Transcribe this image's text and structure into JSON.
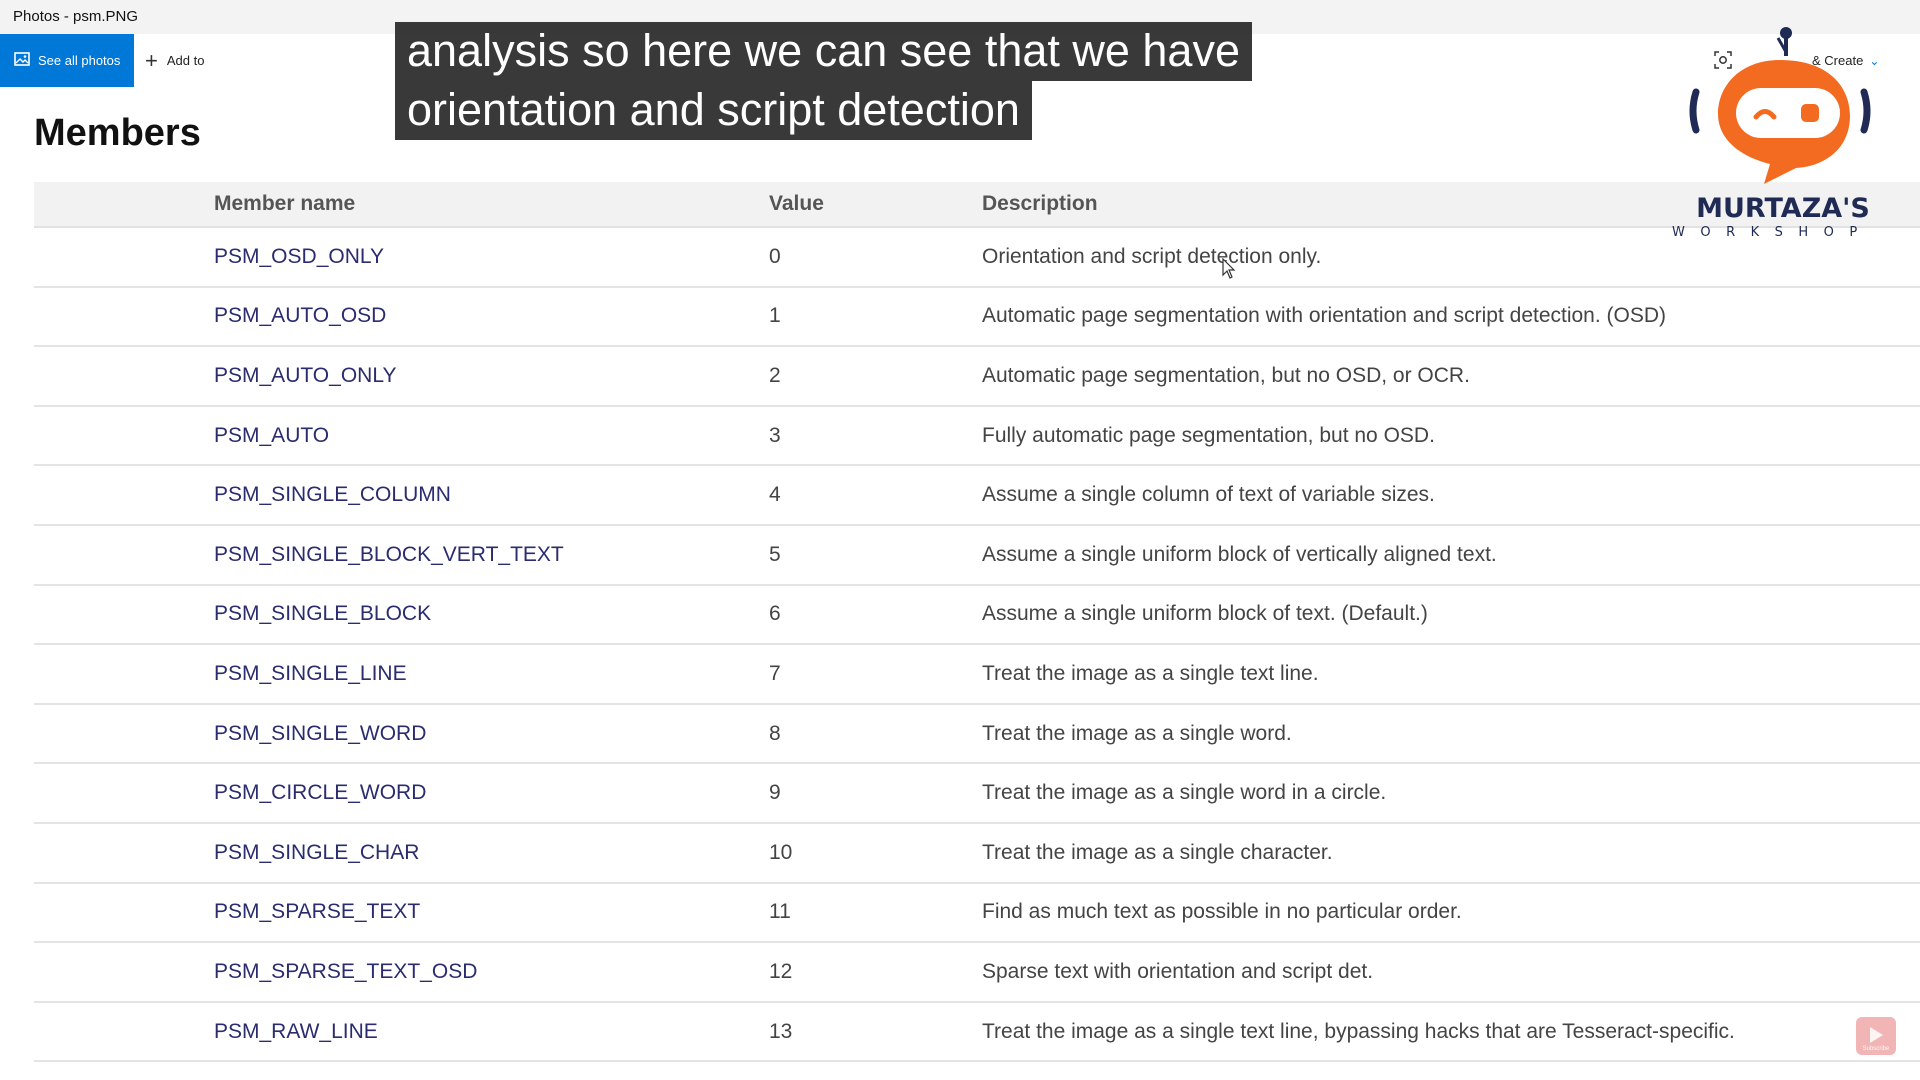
{
  "window": {
    "title": "Photos - psm.PNG"
  },
  "toolbar": {
    "see_all_label": "See all photos",
    "see_all_icon": "photo-library-icon",
    "add_to_label": "Add to",
    "add_to_icon": "plus-icon",
    "edit_create_label": "& Create",
    "edit_create_icon": "chevron-down-icon",
    "accent_color": "#0078d7"
  },
  "page": {
    "title": "Members"
  },
  "table": {
    "headers": {
      "name": "Member name",
      "value": "Value",
      "description": "Description"
    },
    "rows": [
      {
        "name": "PSM_OSD_ONLY",
        "value": "0",
        "description": "Orientation and script detection only."
      },
      {
        "name": "PSM_AUTO_OSD",
        "value": "1",
        "description": "Automatic page segmentation with orientation and script detection. (OSD)"
      },
      {
        "name": "PSM_AUTO_ONLY",
        "value": "2",
        "description": "Automatic page segmentation, but no OSD, or OCR."
      },
      {
        "name": "PSM_AUTO",
        "value": "3",
        "description": "Fully automatic page segmentation, but no OSD."
      },
      {
        "name": "PSM_SINGLE_COLUMN",
        "value": "4",
        "description": "Assume a single column of text of variable sizes."
      },
      {
        "name": "PSM_SINGLE_BLOCK_VERT_TEXT",
        "value": "5",
        "description": "Assume a single uniform block of vertically aligned text."
      },
      {
        "name": "PSM_SINGLE_BLOCK",
        "value": "6",
        "description": "Assume a single uniform block of text. (Default.)"
      },
      {
        "name": "PSM_SINGLE_LINE",
        "value": "7",
        "description": "Treat the image as a single text line."
      },
      {
        "name": "PSM_SINGLE_WORD",
        "value": "8",
        "description": "Treat the image as a single word."
      },
      {
        "name": "PSM_CIRCLE_WORD",
        "value": "9",
        "description": "Treat the image as a single word in a circle."
      },
      {
        "name": "PSM_SINGLE_CHAR",
        "value": "10",
        "description": "Treat the image as a single character."
      },
      {
        "name": "PSM_SPARSE_TEXT",
        "value": "11",
        "description": "Find as much text as possible in no particular order."
      },
      {
        "name": "PSM_SPARSE_TEXT_OSD",
        "value": "12",
        "description": "Sparse text with orientation and script det."
      },
      {
        "name": "PSM_RAW_LINE",
        "value": "13",
        "description": "Treat the image as a single text line, bypassing hacks that are Tesseract-specific."
      }
    ]
  },
  "caption": {
    "line1": "analysis so here we can see that we have",
    "line2": "orientation and script detection"
  },
  "logo": {
    "name": "MURTAZA'S",
    "sub": "WORKSHOP",
    "icon": "robot-logo-icon",
    "brand_color": "#f26b21"
  },
  "subscribe": {
    "label": "Subscribe",
    "icon": "youtube-play-icon"
  }
}
